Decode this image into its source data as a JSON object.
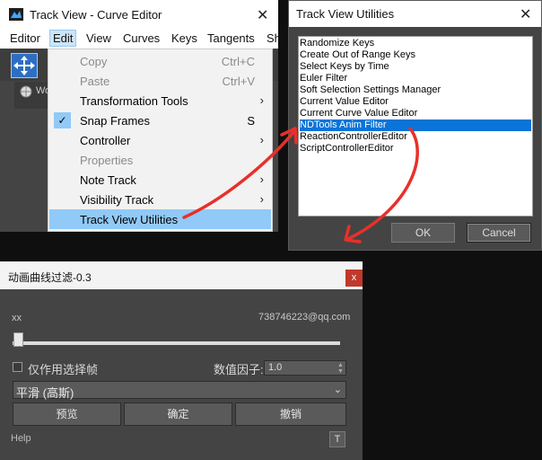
{
  "track_view": {
    "title": "Track View - Curve Editor",
    "close_glyph": "✕",
    "menubar": [
      "Editor",
      "Edit",
      "View",
      "Curves",
      "Keys",
      "Tangents",
      "Sh"
    ],
    "tree_label": "Wo"
  },
  "edit_menu": {
    "items": [
      {
        "label": "Copy",
        "shortcut": "Ctrl+C",
        "disabled": true
      },
      {
        "label": "Paste",
        "shortcut": "Ctrl+V",
        "disabled": true
      },
      {
        "label": "Transformation Tools",
        "submenu": true
      },
      {
        "label": "Snap Frames",
        "shortcut": "S",
        "checked": true
      },
      {
        "label": "Controller",
        "submenu": true
      },
      {
        "label": "Properties",
        "disabled": true
      },
      {
        "label": "Note Track",
        "submenu": true
      },
      {
        "label": "Visibility Track",
        "submenu": true
      },
      {
        "label": "Track View Utilities",
        "highlighted": true
      }
    ]
  },
  "utilities_dialog": {
    "title": "Track View Utilities",
    "close_glyph": "✕",
    "items": [
      "Randomize Keys",
      "Create Out of Range Keys",
      "Select Keys by Time",
      "Euler Filter",
      "Soft Selection Settings Manager",
      "Current Value Editor",
      "Current Curve Value Editor",
      "NDTools Anim Filter",
      "ReactionControllerEditor",
      "ScriptControllerEditor"
    ],
    "selected_index": 7,
    "ok_label": "OK",
    "cancel_label": "Cancel"
  },
  "anim_filter": {
    "title": "动画曲线过滤-0.3",
    "close_glyph": "x",
    "left_label": "xx",
    "right_label": "738746223@qq.com",
    "slider_value": 0,
    "only_selected_frames_label": "仅作用选择帧",
    "only_selected_frames_checked": false,
    "factor_label": "数值因子:",
    "factor_value": "1.0",
    "method": "平滑 (高斯)",
    "preview_label": "预览",
    "confirm_label": "确定",
    "undo_label": "撤销",
    "help_label": "Help",
    "t_button_label": "T"
  },
  "colors": {
    "highlight": "#91c9f7",
    "selection": "#0a74d8",
    "arrow": "#e8302a",
    "dark_bg": "#444444"
  },
  "icons": {
    "move": "move-icon",
    "world": "world-icon",
    "check": "check-icon",
    "submenu": "submenu-arrow-icon"
  }
}
